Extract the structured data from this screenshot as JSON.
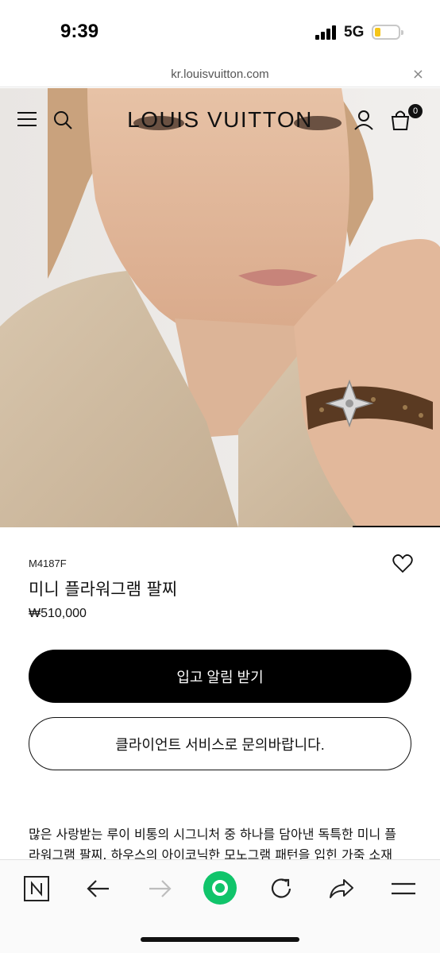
{
  "status": {
    "time": "9:39",
    "network": "5G"
  },
  "browser": {
    "url": "kr.louisvuitton.com",
    "close_glyph": "×"
  },
  "header": {
    "logo": "LOUIS VUITTON",
    "cart_count": "0"
  },
  "product": {
    "sku": "M4187F",
    "name": "미니 플라워그램 팔찌",
    "price": "₩510,000",
    "primary_cta": "입고 알림 받기",
    "secondary_cta": "클라이언트 서비스로 문의바랍니다.",
    "description_line1": "많은 사랑받는 루이 비통의 시그니처 중 하나를 담아낸 독특한 미니 플",
    "description_line2": "라워그램 팔찌. 하우스의 아이코닉한 모노그램 패턴을 입힌 가죽 소재"
  },
  "icons": {
    "menu": "hamburger-menu-icon",
    "search": "search-icon",
    "account": "user-icon",
    "bag": "shopping-bag-icon",
    "wishlist": "heart-icon",
    "browser_home": "n-logo-icon",
    "back": "arrow-left-icon",
    "forward": "arrow-right-icon",
    "record": "green-circle-icon",
    "refresh": "refresh-icon",
    "share": "share-icon",
    "more": "menu-lines-icon"
  },
  "colors": {
    "accent_green": "#10c46a",
    "primary_button": "#000000"
  }
}
